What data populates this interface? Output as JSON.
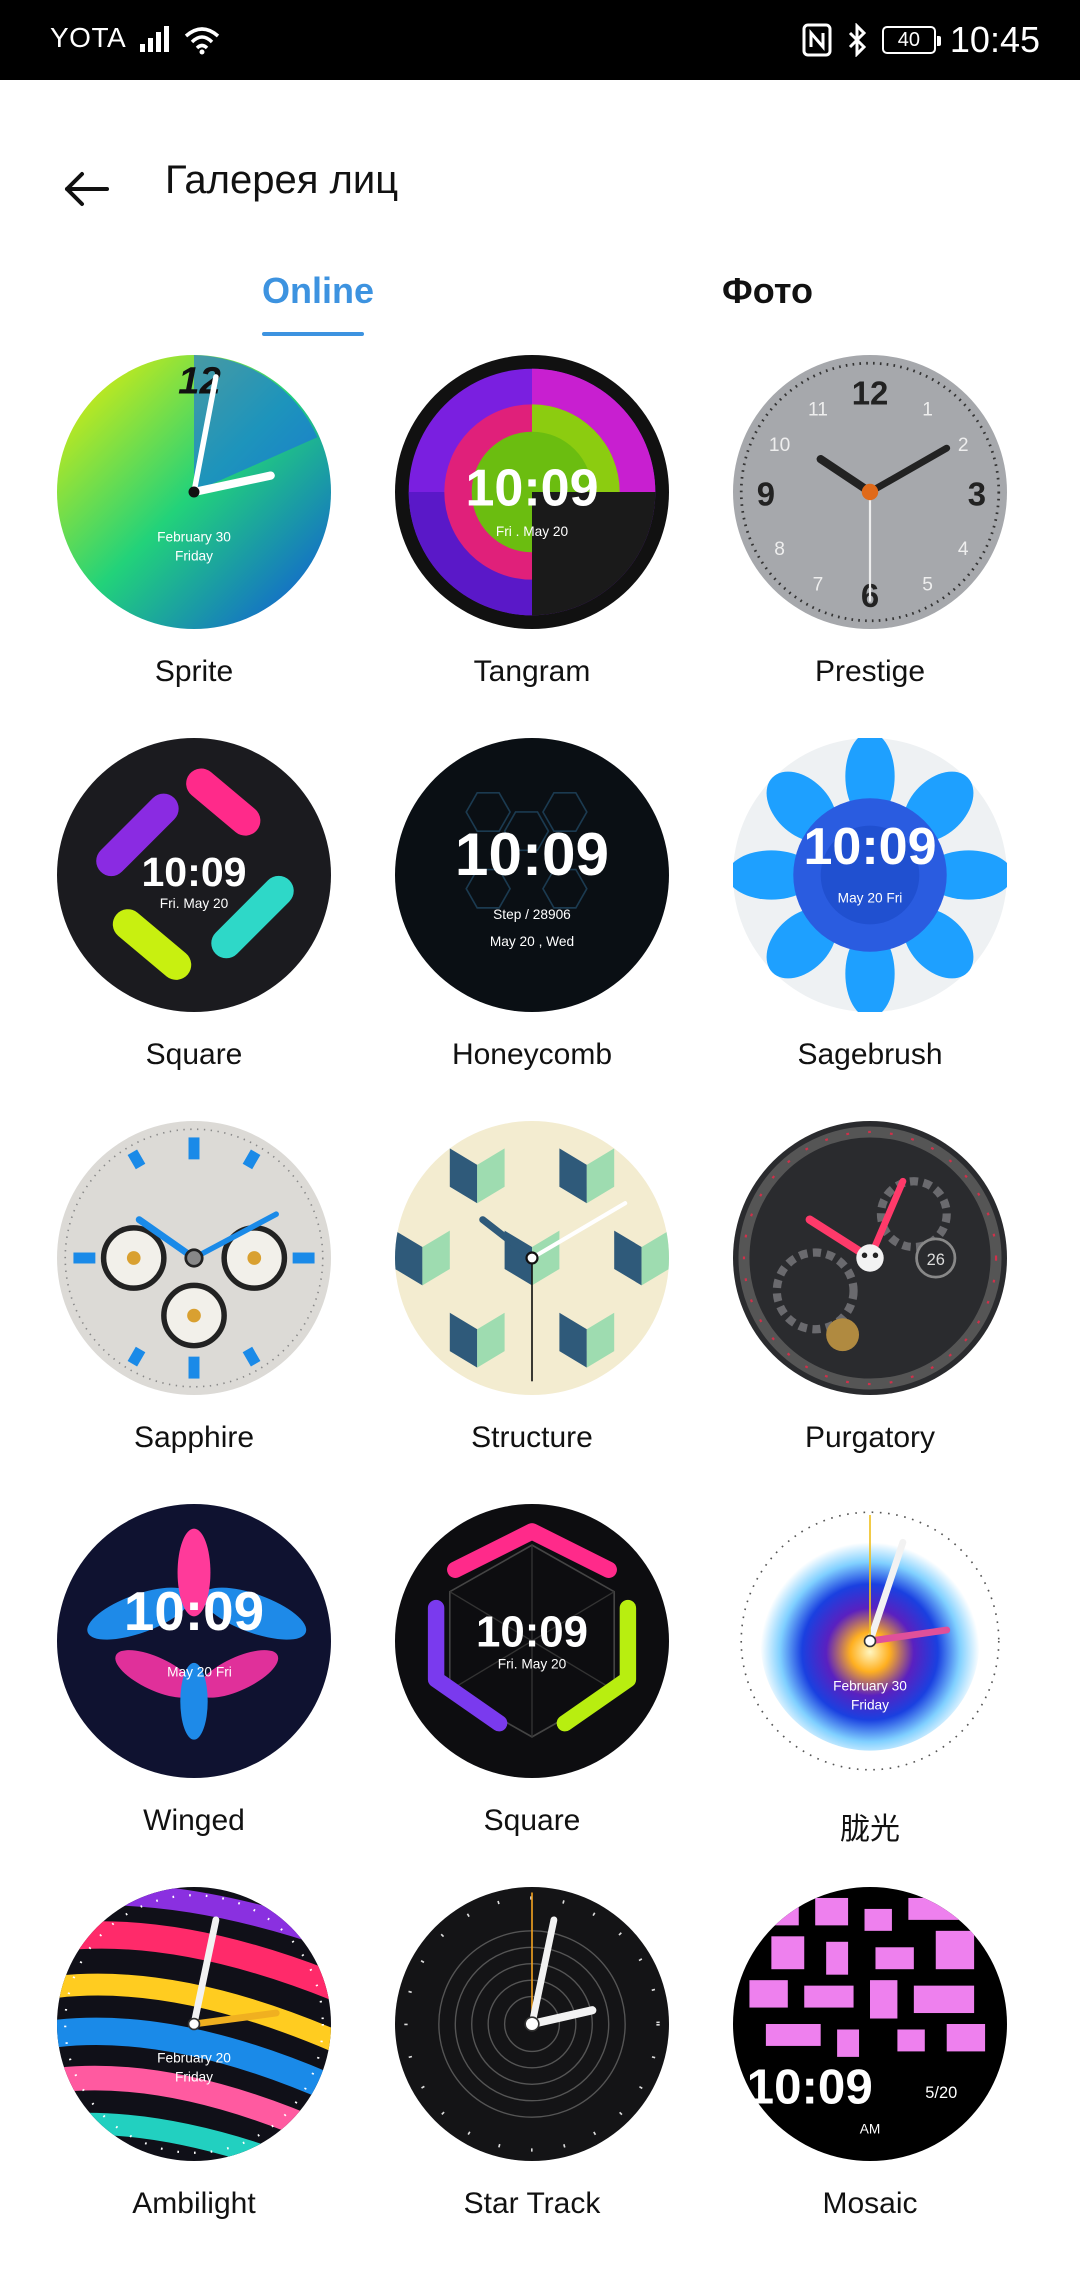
{
  "status_bar": {
    "carrier": "YOTA",
    "battery": "40",
    "time": "10:45"
  },
  "header": {
    "title": "Галерея лиц"
  },
  "tabs": [
    {
      "label": "Online",
      "selected": true
    },
    {
      "label": "Фото",
      "selected": false
    }
  ],
  "accent_color": "#3d93e0",
  "faces": [
    {
      "name": "Sprite",
      "time": "",
      "date": "February 30",
      "day": "Friday"
    },
    {
      "name": "Tangram",
      "time": "10:09",
      "date": "Fri . May 20"
    },
    {
      "name": "Prestige"
    },
    {
      "name": "Square",
      "time": "10:09",
      "date": "Fri. May 20"
    },
    {
      "name": "Honeycomb",
      "time": "10:09",
      "step": "Step / 28906",
      "date": "May 20 , Wed"
    },
    {
      "name": "Sagebrush",
      "time": "10:09",
      "date": "May 20 Fri"
    },
    {
      "name": "Sapphire"
    },
    {
      "name": "Structure"
    },
    {
      "name": "Purgatory",
      "date": "26"
    },
    {
      "name": "Winged",
      "time": "10:09",
      "date": "May 20 Fri"
    },
    {
      "name": "Square",
      "time": "10:09",
      "date": "Fri. May 20"
    },
    {
      "name": "胧光",
      "date": "February 30",
      "day": "Friday"
    },
    {
      "name": "Ambilight",
      "date": "February 20",
      "day": "Friday"
    },
    {
      "name": "Star Track"
    },
    {
      "name": "Mosaic",
      "time": "10:09",
      "date": "5/20",
      "ampm": "AM"
    }
  ]
}
